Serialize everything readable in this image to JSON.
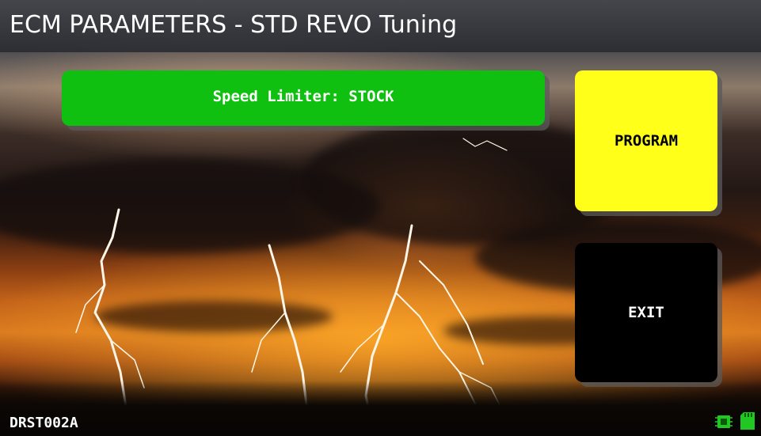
{
  "window": {
    "title": "ECM PARAMETERS - STD REVO Tuning"
  },
  "main": {
    "speed_limiter_label": "Speed Limiter: STOCK"
  },
  "actions": {
    "program_label": "PROGRAM",
    "exit_label": "EXIT"
  },
  "status_bar": {
    "device_id": "DRST002A",
    "icons": [
      "chip-icon",
      "sd-card-icon"
    ],
    "icon_color": "#22c822"
  },
  "colors": {
    "speed_button": "#10c010",
    "program_button": "#ffff1a",
    "exit_button": "#000000",
    "title_bar": "#46484e"
  }
}
